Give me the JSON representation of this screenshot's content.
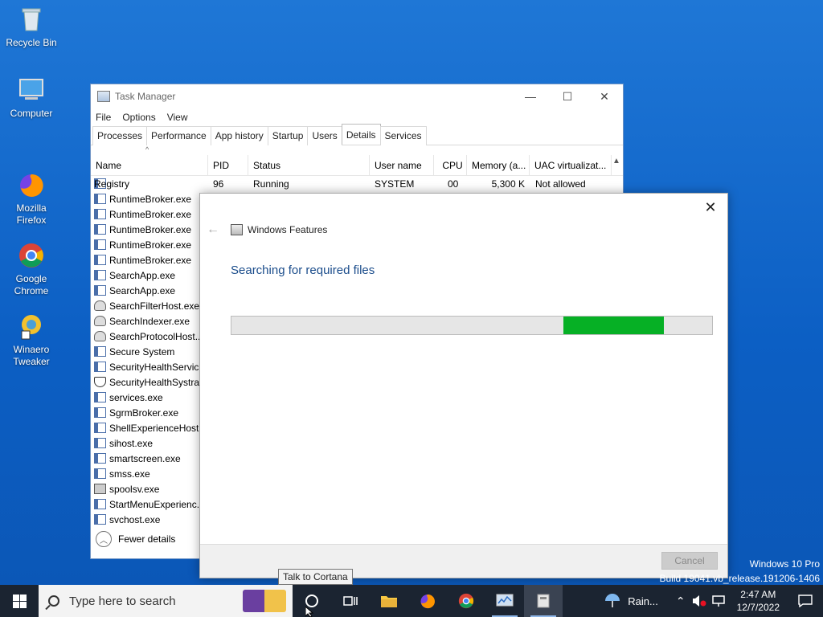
{
  "desktop": {
    "icons": [
      {
        "label": "Recycle Bin",
        "icon": "recycle-bin-icon"
      },
      {
        "label": "Computer",
        "icon": "computer-icon"
      },
      {
        "label": "Mozilla\nFirefox",
        "icon": "firefox-icon"
      },
      {
        "label": "Google\nChrome",
        "icon": "chrome-icon"
      },
      {
        "label": "Winaero\nTweaker",
        "icon": "winaero-icon"
      }
    ]
  },
  "taskmanager": {
    "title": "Task Manager",
    "controls": {
      "minimize": "—",
      "maximize": "☐",
      "close": "✕"
    },
    "menu": [
      "File",
      "Options",
      "View"
    ],
    "tabs": [
      "Processes",
      "Performance",
      "App history",
      "Startup",
      "Users",
      "Details",
      "Services"
    ],
    "active_tab": "Details",
    "columns": [
      "Name",
      "PID",
      "Status",
      "User name",
      "CPU",
      "Memory (a...",
      "UAC virtualizat..."
    ],
    "first_row": {
      "name": "Registry",
      "pid": "96",
      "status": "Running",
      "user": "SYSTEM",
      "cpu": "00",
      "memory": "5,300 K",
      "uac": "Not allowed"
    },
    "rows": [
      {
        "name": "RuntimeBroker.exe",
        "icon": "app"
      },
      {
        "name": "RuntimeBroker.exe",
        "icon": "app"
      },
      {
        "name": "RuntimeBroker.exe",
        "icon": "app"
      },
      {
        "name": "RuntimeBroker.exe",
        "icon": "app"
      },
      {
        "name": "RuntimeBroker.exe",
        "icon": "app"
      },
      {
        "name": "SearchApp.exe",
        "icon": "app"
      },
      {
        "name": "SearchApp.exe",
        "icon": "app"
      },
      {
        "name": "SearchFilterHost.exe",
        "icon": "user"
      },
      {
        "name": "SearchIndexer.exe",
        "icon": "user"
      },
      {
        "name": "SearchProtocolHost...",
        "icon": "user"
      },
      {
        "name": "Secure System",
        "icon": "app"
      },
      {
        "name": "SecurityHealthServic...",
        "icon": "app"
      },
      {
        "name": "SecurityHealthSystra...",
        "icon": "shield"
      },
      {
        "name": "services.exe",
        "icon": "app"
      },
      {
        "name": "SgrmBroker.exe",
        "icon": "app"
      },
      {
        "name": "ShellExperienceHost...",
        "icon": "app"
      },
      {
        "name": "sihost.exe",
        "icon": "app"
      },
      {
        "name": "smartscreen.exe",
        "icon": "app"
      },
      {
        "name": "smss.exe",
        "icon": "app"
      },
      {
        "name": "spoolsv.exe",
        "icon": "printer"
      },
      {
        "name": "StartMenuExperienc...",
        "icon": "app"
      },
      {
        "name": "svchost.exe",
        "icon": "app"
      }
    ],
    "fewer_details": "Fewer details"
  },
  "features_dialog": {
    "title": "Windows Features",
    "heading": "Searching for required files",
    "progress": {
      "start_fraction": 0.69,
      "end_fraction": 0.9,
      "color": "#06b025"
    },
    "cancel_label": "Cancel",
    "close": "✕",
    "back": "←"
  },
  "tooltip": "Talk to Cortana",
  "watermark": {
    "line1": "Windows 10 Pro",
    "line2": "Build 19041.vb_release.191206-1406"
  },
  "taskbar": {
    "search_placeholder": "Type here to search",
    "weather": "Rain...",
    "time": "2:47 AM",
    "date": "12/7/2022"
  }
}
